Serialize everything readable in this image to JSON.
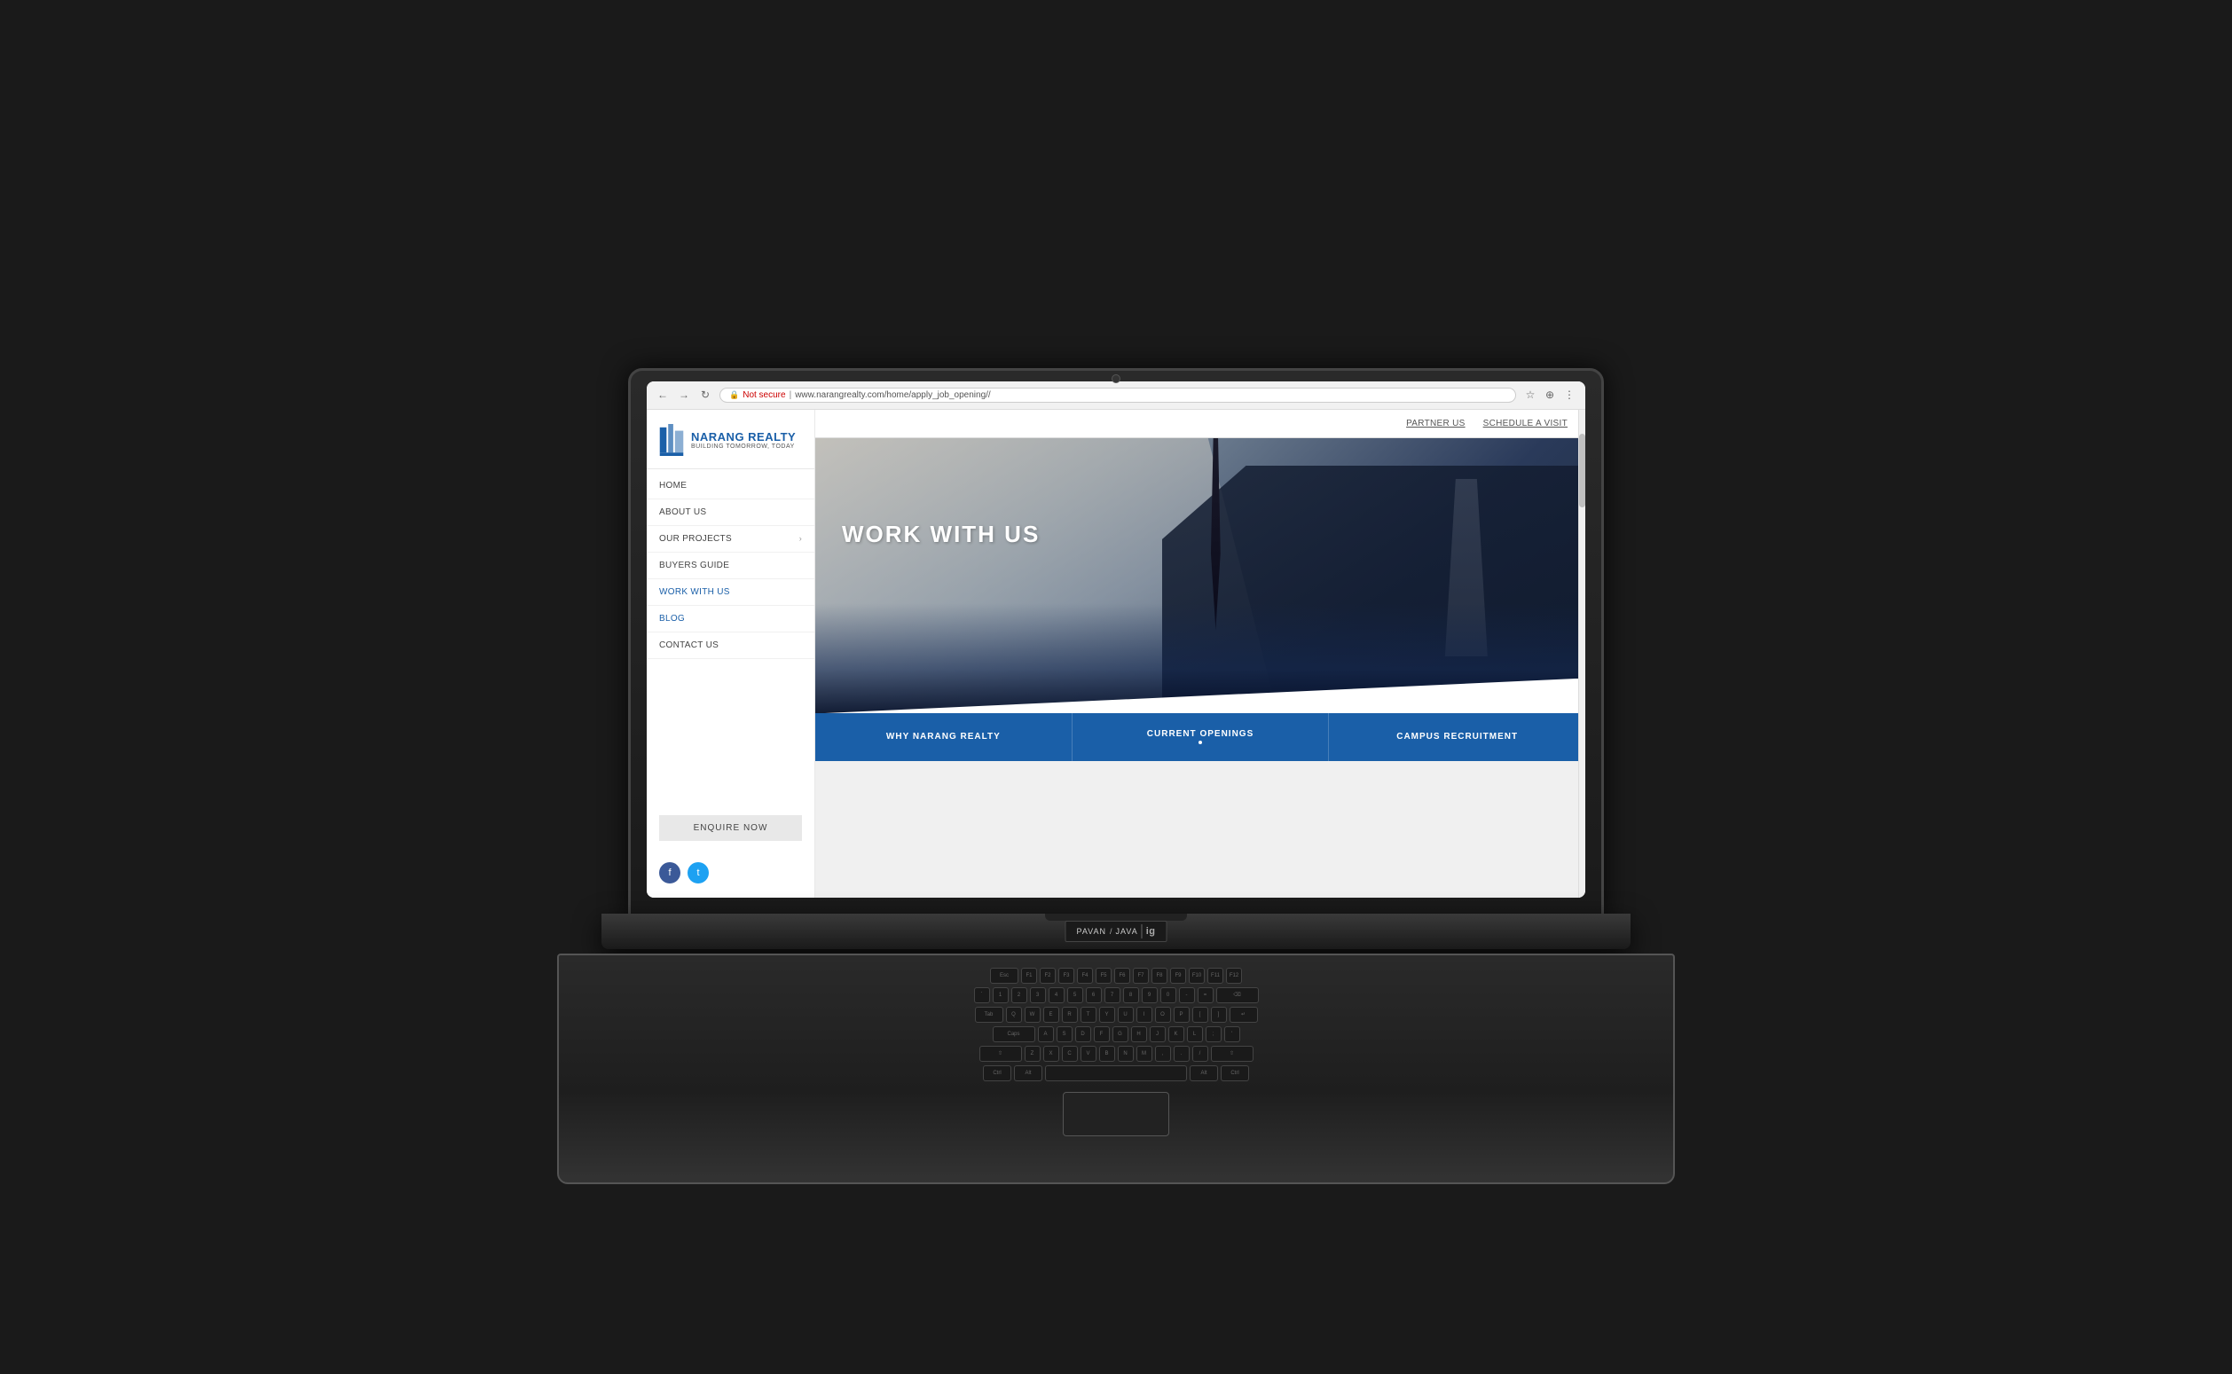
{
  "browser": {
    "url": "www.narangrealty.com/home/apply_job_opening//",
    "security_label": "Not secure",
    "back_btn": "←",
    "forward_btn": "→",
    "refresh_btn": "↻"
  },
  "header": {
    "partner_link": "PARTNER US",
    "schedule_link": "SCHEDULE A VISIT"
  },
  "logo": {
    "name": "NARANG REALTY",
    "tagline": "BUILDING TOMORROW, TODAY"
  },
  "nav": {
    "items": [
      {
        "label": "HOME",
        "active": false,
        "has_submenu": false
      },
      {
        "label": "ABOUT US",
        "active": false,
        "has_submenu": false
      },
      {
        "label": "OUR PROJECTS",
        "active": false,
        "has_submenu": true
      },
      {
        "label": "BUYERS GUIDE",
        "active": false,
        "has_submenu": false
      },
      {
        "label": "WORK WITH US",
        "active": true,
        "has_submenu": false
      },
      {
        "label": "BLOG",
        "active": false,
        "has_submenu": false
      },
      {
        "label": "CONTACT US",
        "active": false,
        "has_submenu": false
      }
    ],
    "enquire_btn": "ENQUIRE NOW"
  },
  "hero": {
    "title": "WORK WITH US"
  },
  "tabs": [
    {
      "label": "WHY NARANG REALTY",
      "has_dot": false
    },
    {
      "label": "CURRENT OPENINGS",
      "has_dot": true
    },
    {
      "label": "CAMPUS RECRUITMENT",
      "has_dot": false
    }
  ],
  "laptop_brand": {
    "text1": "PAVAN",
    "text2": "JAVA",
    "logo": "ig"
  }
}
